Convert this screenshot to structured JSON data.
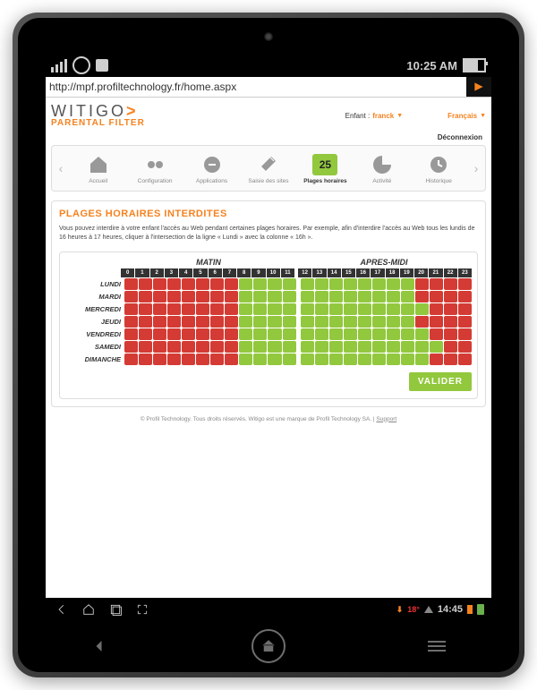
{
  "device": {
    "status_left_icons": [
      "signal",
      "wifi",
      "app"
    ],
    "time_top": "10:25 AM",
    "bottom_time": "14:45",
    "bottom_temp": "18°"
  },
  "browser": {
    "url": "http://mpf.profiltechnology.fr/home.aspx"
  },
  "brand": {
    "name": "WITIGO",
    "chevron": ">",
    "sub": "PARENTAL FILTER"
  },
  "header": {
    "child_label": "Enfant :",
    "child_value": "franck",
    "lang_value": "Français",
    "logout": "Déconnexion"
  },
  "nav": {
    "items": [
      {
        "id": "accueil",
        "label": "Accueil"
      },
      {
        "id": "configuration",
        "label": "Configuration"
      },
      {
        "id": "applications",
        "label": "Applications"
      },
      {
        "id": "saisie",
        "label": "Saisie des sites"
      },
      {
        "id": "plages",
        "label": "Plages horaires",
        "active": true,
        "badge": "25"
      },
      {
        "id": "activite",
        "label": "Activité"
      },
      {
        "id": "historique",
        "label": "Historique"
      }
    ]
  },
  "content": {
    "title": "PLAGES HORAIRES INTERDITES",
    "intro": "Vous pouvez interdire à votre enfant l'accès au Web pendant certaines plages horaires. Par exemple, afin d'interdire l'accès au Web tous les lundis de 16 heures à 17 heures, cliquer à l'intersection de la ligne « Lundi » avec la colonne « 16h »."
  },
  "schedule": {
    "period_labels": [
      "MATIN",
      "APRES-MIDI"
    ],
    "hours_am": [
      "0",
      "1",
      "2",
      "3",
      "4",
      "5",
      "6",
      "7",
      "8",
      "9",
      "10",
      "11"
    ],
    "hours_pm": [
      "12",
      "13",
      "14",
      "15",
      "16",
      "17",
      "18",
      "19",
      "20",
      "21",
      "22",
      "23"
    ],
    "days": [
      "LUNDI",
      "MARDI",
      "MERCREDI",
      "JEUDI",
      "VENDREDI",
      "SAMEDI",
      "DIMANCHE"
    ],
    "blocked": {
      "LUNDI": [
        1,
        1,
        1,
        1,
        1,
        1,
        1,
        1,
        0,
        0,
        0,
        0,
        0,
        0,
        0,
        0,
        0,
        0,
        0,
        0,
        1,
        1,
        1,
        1
      ],
      "MARDI": [
        1,
        1,
        1,
        1,
        1,
        1,
        1,
        1,
        0,
        0,
        0,
        0,
        0,
        0,
        0,
        0,
        0,
        0,
        0,
        0,
        1,
        1,
        1,
        1
      ],
      "MERCREDI": [
        1,
        1,
        1,
        1,
        1,
        1,
        1,
        1,
        0,
        0,
        0,
        0,
        0,
        0,
        0,
        0,
        0,
        0,
        0,
        0,
        0,
        1,
        1,
        1
      ],
      "JEUDI": [
        1,
        1,
        1,
        1,
        1,
        1,
        1,
        1,
        0,
        0,
        0,
        0,
        0,
        0,
        0,
        0,
        0,
        0,
        0,
        0,
        1,
        1,
        1,
        1
      ],
      "VENDREDI": [
        1,
        1,
        1,
        1,
        1,
        1,
        1,
        1,
        0,
        0,
        0,
        0,
        0,
        0,
        0,
        0,
        0,
        0,
        0,
        0,
        0,
        1,
        1,
        1
      ],
      "SAMEDI": [
        1,
        1,
        1,
        1,
        1,
        1,
        1,
        1,
        0,
        0,
        0,
        0,
        0,
        0,
        0,
        0,
        0,
        0,
        0,
        0,
        0,
        0,
        1,
        1
      ],
      "DIMANCHE": [
        1,
        1,
        1,
        1,
        1,
        1,
        1,
        1,
        0,
        0,
        0,
        0,
        0,
        0,
        0,
        0,
        0,
        0,
        0,
        0,
        0,
        1,
        1,
        1
      ]
    },
    "validate_label": "VALIDER"
  },
  "footer": {
    "text": "© Profil Technology. Tous droits réservés. Witigo est une marque de Profil Technology SA.   |   ",
    "support": "Support"
  },
  "colors": {
    "accent": "#f58220",
    "green": "#92c83e",
    "red": "#d43b34"
  }
}
